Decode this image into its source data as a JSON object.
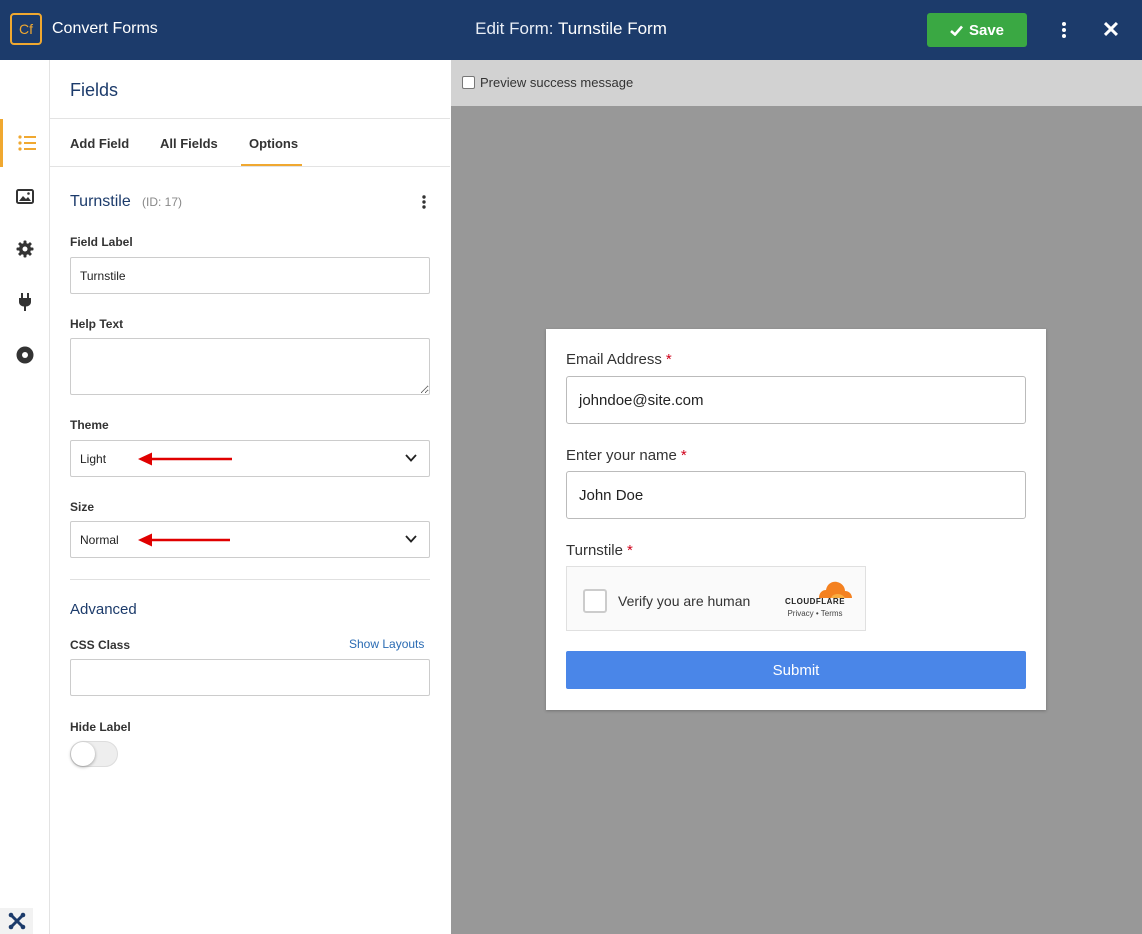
{
  "app": {
    "logo_text": "Cf",
    "name": "Convert Forms"
  },
  "header": {
    "title_prefix": "Edit Form:",
    "title_name": "Turnstile Form",
    "save_label": "Save"
  },
  "rail": {
    "items": [
      "list-icon",
      "image-icon",
      "gear-icon",
      "plug-icon",
      "circle-dot-icon"
    ],
    "active": "list-icon",
    "bottom": "joomla-icon"
  },
  "panel": {
    "title": "Fields",
    "tabs": [
      {
        "label": "Add Field"
      },
      {
        "label": "All Fields"
      },
      {
        "label": "Options",
        "active": true
      }
    ],
    "field": {
      "name": "Turnstile",
      "id_text": "(ID: 17)"
    },
    "field_label": {
      "label": "Field Label",
      "value": "Turnstile"
    },
    "help_text": {
      "label": "Help Text",
      "value": ""
    },
    "theme": {
      "label": "Theme",
      "value": "Light"
    },
    "size": {
      "label": "Size",
      "value": "Normal"
    },
    "advanced": {
      "title": "Advanced"
    },
    "css_class": {
      "label": "CSS Class",
      "link": "Show Layouts",
      "value": ""
    },
    "hide_label": {
      "label": "Hide Label",
      "on": false
    }
  },
  "preview": {
    "success_label": "Preview success message",
    "form": {
      "email": {
        "label": "Email Address",
        "required": "*",
        "value": "johndoe@site.com"
      },
      "name": {
        "label": "Enter your name",
        "required": "*",
        "value": "John Doe"
      },
      "turnstile": {
        "label": "Turnstile",
        "required": "*",
        "widget_text": "Verify you are human",
        "brand": "CLOUDFLARE",
        "links": "Privacy • Terms"
      },
      "submit": "Submit"
    }
  },
  "colors": {
    "topbar": "#1c3b6b",
    "accent": "#f0a830",
    "save": "#3aa843",
    "submit": "#4a86e8",
    "annotation_arrow": "#e00000",
    "required": "#d0021b"
  }
}
